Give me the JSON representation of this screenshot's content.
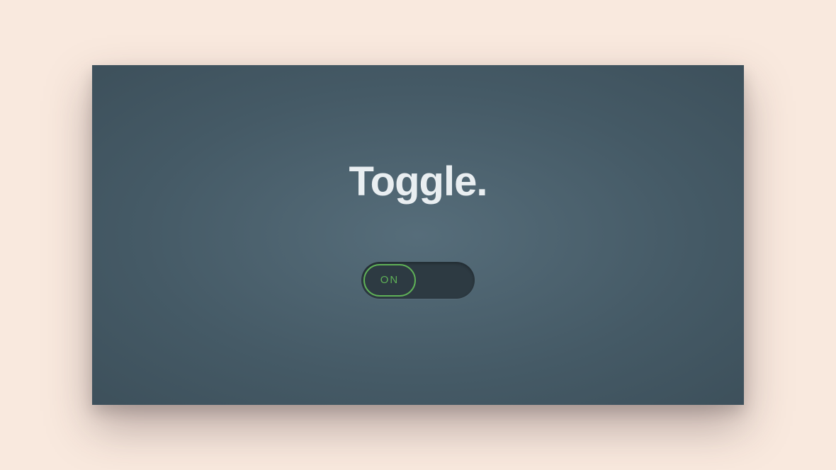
{
  "title": "Toggle.",
  "toggle": {
    "state_label": "ON"
  }
}
